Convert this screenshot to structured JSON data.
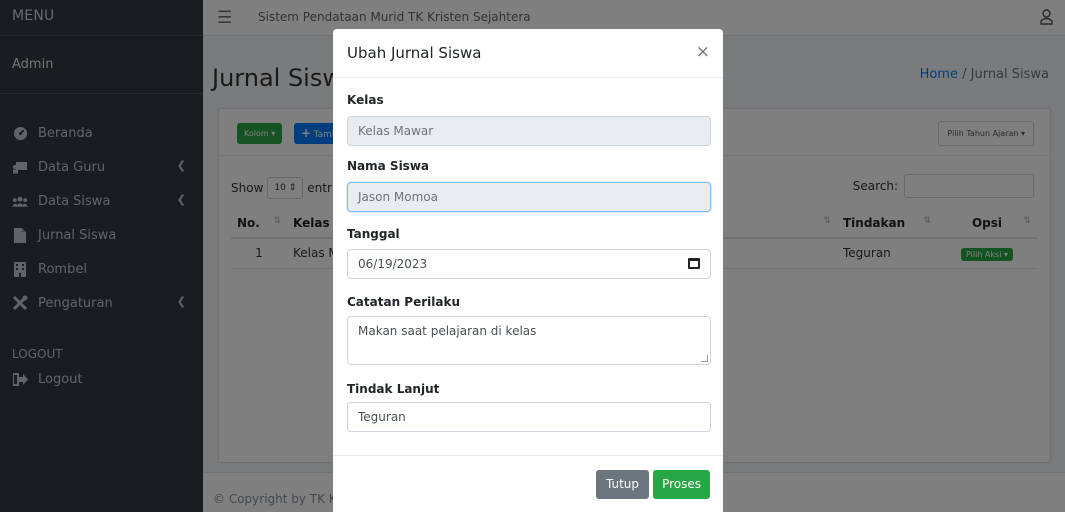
{
  "sidebar": {
    "brand": "MENU",
    "user": "Admin",
    "items": [
      {
        "label": "Beranda",
        "icon": "tachometer-icon"
      },
      {
        "label": "Data Guru",
        "icon": "teacher-icon"
      },
      {
        "label": "Data Siswa",
        "icon": "users-icon"
      },
      {
        "label": "Jurnal Siswa",
        "icon": "file-icon"
      },
      {
        "label": "Rombel",
        "icon": "building-icon"
      },
      {
        "label": "Pengaturan",
        "icon": "tools-icon"
      }
    ],
    "section_logout": "LOGOUT",
    "logout": "Logout"
  },
  "navbar": {
    "title": "Sistem Pendataan Murid TK Kristen Sejahtera"
  },
  "page": {
    "title": "Jurnal Siswa",
    "breadcrumb_home": "Home",
    "breadcrumb_sep": "/",
    "breadcrumb_current": "Jurnal Siswa"
  },
  "card": {
    "kolom_label": "Kolom",
    "tambah_label": "Tambah",
    "tahun_label": "Pilih Tahun Ajaran",
    "show_label": "Show",
    "show_value": "10",
    "entries_label": "entries",
    "search_label": "Search:"
  },
  "table": {
    "headers": {
      "no": "No.",
      "kelas": "Kelas",
      "tindakan": "Tindakan",
      "opsi": "Opsi"
    },
    "rows": [
      {
        "no": "1",
        "kelas": "Kelas Mawar",
        "catatan": "Makan saat pelajaran di kelas",
        "tindakan": "Teguran",
        "aksi": "Pilih Aksi"
      }
    ]
  },
  "footer": {
    "copyright": "© Copyright by TK Kristen Sejahtera"
  },
  "modal": {
    "title": "Ubah Jurnal Siswa",
    "close": "×",
    "kelas_label": "Kelas",
    "kelas_value": "Kelas Mawar",
    "nama_label": "Nama Siswa",
    "nama_value": "Jason Momoa",
    "tanggal_label": "Tanggal",
    "tanggal_value": "06/19/2023",
    "catatan_label": "Catatan Perilaku",
    "catatan_value": "Makan saat pelajaran di kelas",
    "tindak_label": "Tindak Lanjut",
    "tindak_value": "Teguran",
    "tutup_label": "Tutup",
    "proses_label": "Proses"
  },
  "colors": {
    "sidebar_bg": "#343a40",
    "primary": "#007bff",
    "success": "#28a745",
    "secondary": "#6c757d"
  }
}
